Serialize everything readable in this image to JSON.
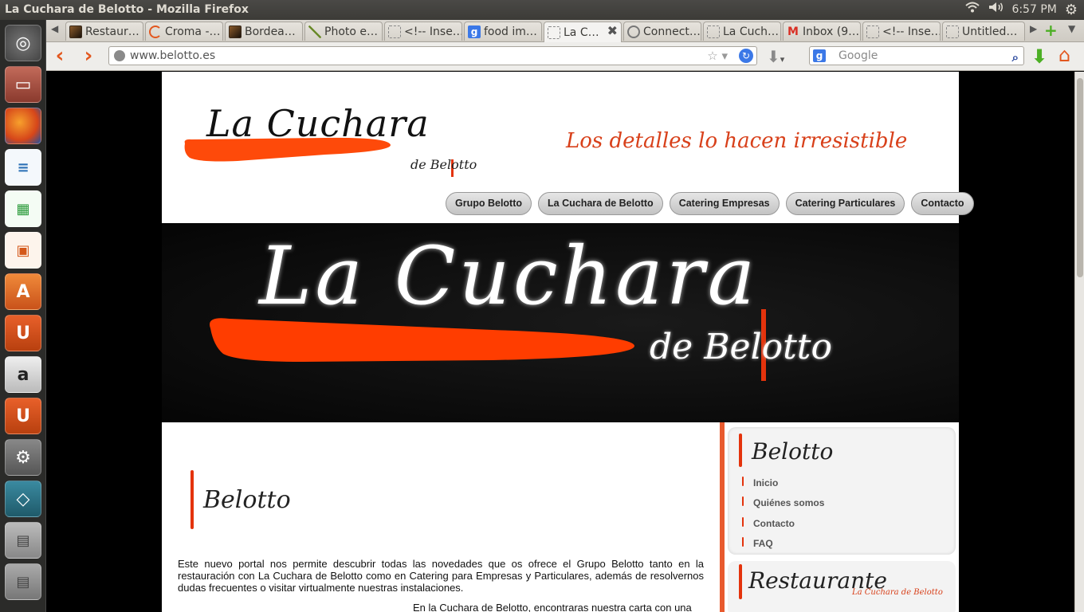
{
  "window": {
    "title": "La Cuchara de Belotto - Mozilla Firefox",
    "clock": "6:57 PM"
  },
  "tabs": [
    {
      "label": "Restaur…",
      "icon": "image-favicon"
    },
    {
      "label": "Croma -…",
      "icon": "croma-favicon"
    },
    {
      "label": "Bordea…",
      "icon": "image-favicon"
    },
    {
      "label": "Photo e…",
      "icon": "pen-favicon"
    },
    {
      "label": "<!-- Inse…",
      "icon": "blank-favicon"
    },
    {
      "label": "food im…",
      "icon": "google-favicon"
    },
    {
      "label": "La C…",
      "icon": "blank-favicon"
    },
    {
      "label": "Connect…",
      "icon": "loading-favicon"
    },
    {
      "label": "La Cuch…",
      "icon": "blank-favicon"
    },
    {
      "label": "Inbox (9…",
      "icon": "gmail-favicon"
    },
    {
      "label": "<!-- Inse…",
      "icon": "blank-favicon"
    },
    {
      "label": "Untitled…",
      "icon": "blank-favicon"
    }
  ],
  "nav": {
    "url": "www.belotto.es",
    "search_placeholder": "Google"
  },
  "site": {
    "logo_title": "La Cuchara",
    "logo_sub": "de Belotto",
    "tagline": "Los detalles lo hacen irresistible",
    "menu": [
      "Grupo Belotto",
      "La Cuchara de Belotto",
      "Catering Empresas",
      "Catering Particulares",
      "Contacto"
    ],
    "banner_title": "La Cuchara",
    "banner_sub": "de Belotto",
    "main_title": "Belotto",
    "paragraph": "Este nuevo portal nos permite descubrir todas las novedades que os ofrece el Grupo Belotto tanto en la restauración con La Cuchara de Belotto como en Catering para Empresas y Particulares, además de resolvernos dudas frecuentes o visitar virtualmente nuestras instalaciones.",
    "paragraph2": "En la Cuchara de Belotto, encontraras nuestra carta con una",
    "sidebar": {
      "title": "Belotto",
      "links": [
        "Inicio",
        "Quiénes somos",
        "Contacto",
        "FAQ"
      ],
      "title2": "Restaurante",
      "sub2": "La Cuchara de Belotto"
    }
  },
  "colors": {
    "accent": "#e4330c",
    "launcher": "#2b2b29"
  }
}
